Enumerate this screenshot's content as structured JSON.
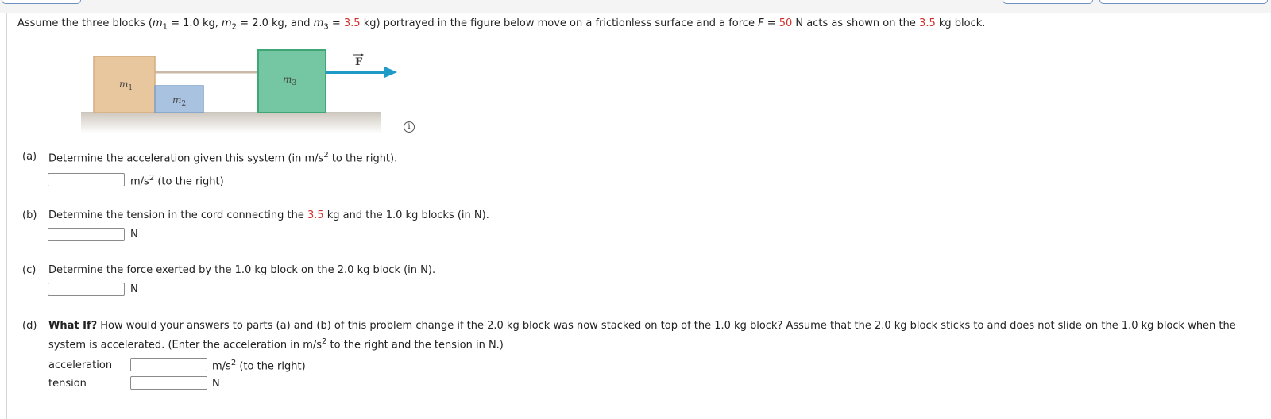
{
  "intro": {
    "t1": "Assume the three blocks (",
    "m1_sym": "m",
    "m1_sub": "1",
    "m1_val": " = 1.0 kg, ",
    "m2_sym": "m",
    "m2_sub": "2",
    "m2_val": " = 2.0 kg, and ",
    "m3_sym": "m",
    "m3_sub": "3",
    "m3_eq": " = ",
    "m3_val": "3.5",
    "t2": " kg) portrayed in the figure below move on a frictionless surface and a force ",
    "F_sym": "F",
    "F_eq": " = ",
    "F_val": "50",
    "t3": " N acts as shown on the ",
    "m3_val2": "3.5",
    "t4": " kg block."
  },
  "figure": {
    "m1_label": "m",
    "m1_sub": "1",
    "m2_label": "m",
    "m2_sub": "2",
    "m3_label": "m",
    "m3_sub": "3",
    "force_label": "F",
    "info_icon": "info-icon"
  },
  "part_a": {
    "letter": "(a)",
    "question_pre": "Determine the acceleration given this system (in m/s",
    "question_sup": "2",
    "question_post": " to the right).",
    "unit_pre": "m/s",
    "unit_sup": "2",
    "unit_post": " (to the right)"
  },
  "part_b": {
    "letter": "(b)",
    "question_pre": "Determine the tension in the cord connecting the ",
    "question_red": "3.5",
    "question_post": " kg and the 1.0 kg blocks (in N).",
    "unit": "N"
  },
  "part_c": {
    "letter": "(c)",
    "question": "Determine the force exerted by the 1.0 kg block on the 2.0 kg block (in N).",
    "unit": "N"
  },
  "part_d": {
    "letter": "(d)",
    "bold": "What If?",
    "line1": " How would your answers to parts (a) and (b) of this problem change if the 2.0 kg block was now stacked on top of the 1.0 kg block? Assume that the 2.0 kg block sticks to and does not slide on the 1.0 kg block when the",
    "line2_pre": "system is accelerated. (Enter the acceleration in m/s",
    "line2_sup": "2",
    "line2_post": " to the right and the tension in N.)",
    "accel_label": "acceleration",
    "accel_unit_pre": "m/s",
    "accel_unit_sup": "2",
    "accel_unit_post": " (to the right)",
    "tension_label": "tension",
    "tension_unit": "N"
  },
  "colors": {
    "accent_red": "#d0312d",
    "block_m1": "#e8c79e",
    "block_m2": "#a9c2e0",
    "block_m3": "#74c7a2",
    "arrow": "#1f9bc8"
  }
}
